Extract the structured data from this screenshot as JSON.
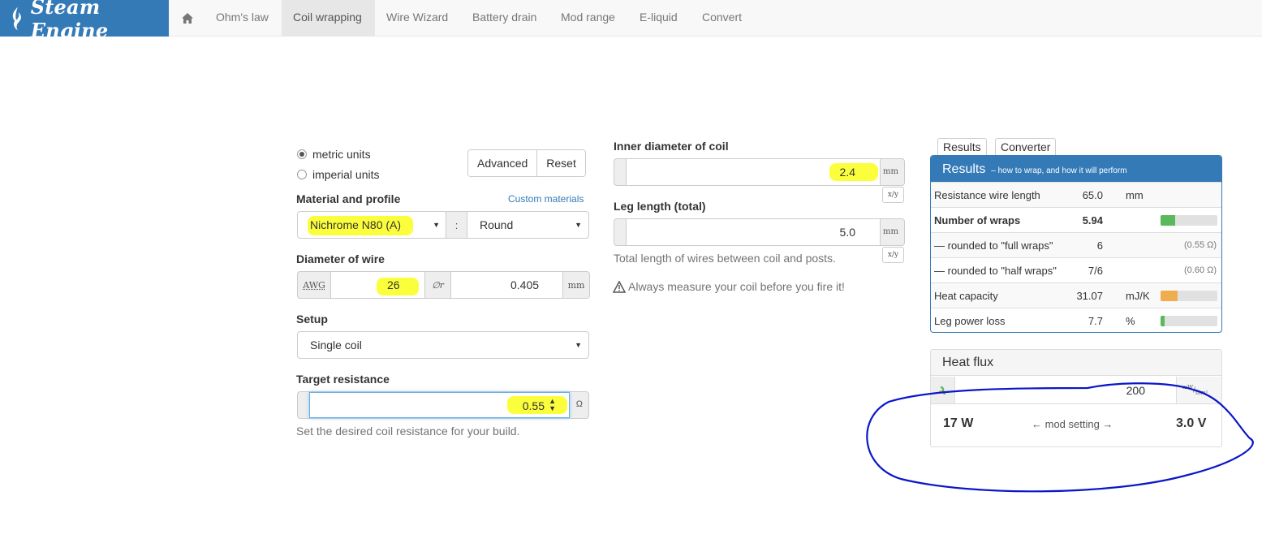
{
  "nav": {
    "brand": "Steam Engine",
    "items": [
      "Ohm's law",
      "Coil wrapping",
      "Wire Wizard",
      "Battery drain",
      "Mod range",
      "E-liquid",
      "Convert"
    ],
    "active_index": 1
  },
  "units": {
    "metric": "metric units",
    "imperial": "imperial units",
    "selected": "metric"
  },
  "buttons": {
    "advanced": "Advanced",
    "reset": "Reset"
  },
  "material": {
    "label": "Material and profile",
    "custom_link": "Custom materials",
    "material_value": "Nichrome N80 (A)",
    "separator": ":",
    "profile_value": "Round"
  },
  "wire": {
    "label": "Diameter of wire",
    "awg_addon": "AWG",
    "awg_value": "26",
    "diam_addon": "∅r",
    "diam_value": "0.405",
    "unit": "mm"
  },
  "setup": {
    "label": "Setup",
    "value": "Single coil"
  },
  "target": {
    "label": "Target resistance",
    "value": "0.55",
    "unit": "Ω",
    "help": "Set the desired coil resistance for your build."
  },
  "inner": {
    "label": "Inner diameter of coil",
    "value": "2.4",
    "unit": "mm",
    "xy": "x/y"
  },
  "leg": {
    "label": "Leg length (total)",
    "value": "5.0",
    "unit": "mm",
    "xy": "x/y",
    "help": "Total length of wires between coil and posts."
  },
  "warning": "Always measure your coil before you fire it!",
  "tabs": [
    "Results",
    "Converter"
  ],
  "results": {
    "title": "Results",
    "subtitle": "– how to wrap, and how it will perform",
    "rows": [
      {
        "label": "Resistance wire length",
        "value": "65.0",
        "unit": "mm",
        "extra": "",
        "bar": null
      },
      {
        "label": "Number of wraps",
        "value": "5.94",
        "unit": "",
        "extra": "",
        "bar": 0.25,
        "bar_color": "#5cb85c"
      },
      {
        "label": "— rounded to \"full wraps\"",
        "value": "6",
        "unit": "",
        "extra": "(0.55 Ω)",
        "bar": null
      },
      {
        "label": "— rounded to \"half wraps\"",
        "value": "7/6",
        "unit": "",
        "extra": "(0.60 Ω)",
        "bar": null
      },
      {
        "label": "Heat capacity",
        "value": "31.07",
        "unit": "mJ/K",
        "extra": "",
        "bar": 0.3,
        "bar_color": "#f0ad4e"
      },
      {
        "label": "Leg power loss",
        "value": "7.7",
        "unit": "%",
        "extra": "",
        "bar": 0.07,
        "bar_color": "#5cb85c"
      }
    ]
  },
  "heat_flux": {
    "title": "Heat flux",
    "value": "200",
    "unit_num": "mW",
    "unit_den": "mm²",
    "power": "17 W",
    "mod_setting": "← mod setting →",
    "voltage": "3.0 V"
  },
  "colors": {
    "brand": "#337ab7",
    "highlight": "#fbff3b",
    "annotation": "#0b16c9"
  }
}
